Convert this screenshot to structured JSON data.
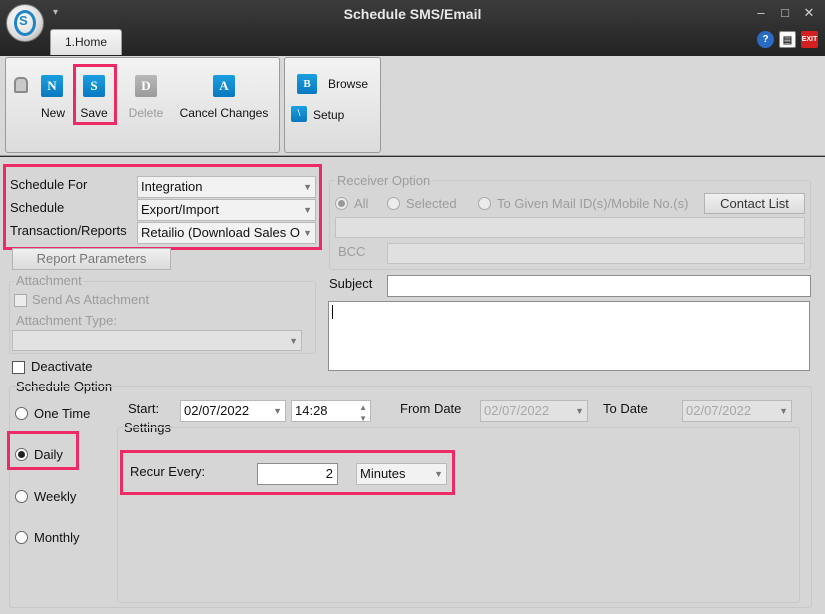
{
  "window": {
    "title": "Schedule SMS/Email",
    "quick_access_arrow": "▾",
    "minimize": "–",
    "maximize": "□",
    "close": "✕",
    "logo_letter": "S"
  },
  "tabs": [
    {
      "label": "1.Home",
      "active": true
    }
  ],
  "toolbar_right_icons": [
    {
      "name": "help-icon",
      "glyph": "?"
    },
    {
      "name": "document-icon",
      "glyph": "▤"
    },
    {
      "name": "exit-icon",
      "glyph": "EXIT"
    }
  ],
  "ribbon": {
    "new": {
      "label": "New",
      "icon_letter": "N",
      "enabled": true
    },
    "save": {
      "label": "Save",
      "icon_letter": "S",
      "enabled": true
    },
    "delete": {
      "label": "Delete",
      "icon_letter": "D",
      "enabled": false
    },
    "cancel": {
      "label": "Cancel Changes",
      "icon_letter": "A",
      "enabled": true
    },
    "browse": {
      "label": "Browse",
      "icon_letter": "B"
    },
    "setup": {
      "label": "Setup",
      "icon_letter": "\\"
    }
  },
  "schedule": {
    "schedule_for_label": "Schedule For",
    "schedule_for_value": "Integration",
    "schedule_label": "Schedule",
    "schedule_value": "Export/Import",
    "transaction_label": "Transaction/Reports",
    "transaction_value": "Retailio (Download Sales O"
  },
  "report_parameters_button": "Report Parameters",
  "attachment": {
    "group_label": "Attachment",
    "send_as_attachment_label": "Send As Attachment",
    "send_as_attachment_checked": false,
    "type_label": "Attachment Type:",
    "type_value": ""
  },
  "deactivate": {
    "label": "Deactivate",
    "checked": false
  },
  "receiver": {
    "group_label": "Receiver Option",
    "options": [
      {
        "label": "All",
        "checked": true
      },
      {
        "label": "Selected",
        "checked": false
      },
      {
        "label": "To Given Mail ID(s)/Mobile No.(s)",
        "checked": false
      }
    ],
    "contact_list_button": "Contact List",
    "recipients_value": "",
    "bcc_label": "BCC",
    "bcc_value": ""
  },
  "message": {
    "subject_label": "Subject",
    "subject_value": "",
    "body_value": ""
  },
  "schedule_option": {
    "group_label": "Schedule Option",
    "options": [
      {
        "label": "One Time",
        "checked": false
      },
      {
        "label": "Daily",
        "checked": true
      },
      {
        "label": "Weekly",
        "checked": false
      },
      {
        "label": "Monthly",
        "checked": false
      }
    ],
    "start_label": "Start:",
    "start_date": "02/07/2022",
    "start_time": "14:28",
    "from_date_label": "From Date",
    "from_date_value": "02/07/2022",
    "to_date_label": "To Date",
    "to_date_value": "02/07/2022",
    "settings_label": "Settings",
    "recur_every_label": "Recur Every:",
    "recur_value": "2",
    "recur_unit": "Minutes"
  },
  "colors": {
    "highlight": "#ec2a66",
    "ribbon_icon_blue": "#1a9fe0",
    "title_bar": "#2e2e2e",
    "form_background": "#d6d6d6"
  }
}
